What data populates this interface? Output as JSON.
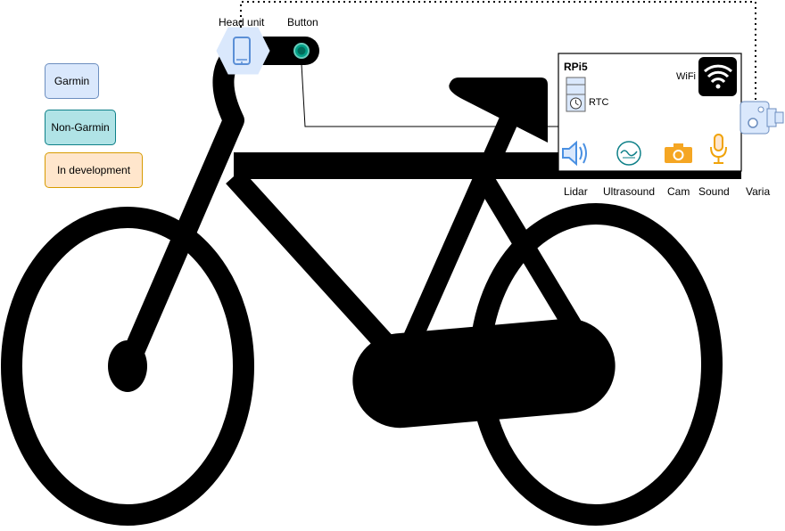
{
  "legend": [
    {
      "label": "Garmin",
      "fill": "#dae8fc",
      "stroke": "#6c8ebf"
    },
    {
      "label": "Non-Garmin",
      "fill": "#b0e3e6",
      "stroke": "#0e8088"
    },
    {
      "label": "In development",
      "fill": "#ffe6cc",
      "stroke": "#d79b00"
    }
  ],
  "labels": {
    "head_unit": "Head unit",
    "button": "Button",
    "rpi": "RPi5",
    "wifi": "WiFi",
    "rtc": "RTC",
    "lidar": "Lidar",
    "ultrasound": "Ultrasound",
    "cam": "Cam",
    "sound": "Sound",
    "varia": "Varia"
  },
  "colors": {
    "garmin_fill": "#dae8fc",
    "garmin_stroke": "#6c8ebf",
    "button_accent": "#00a087",
    "sensor_blue": "#4a90e2",
    "camera_orange": "#f5a623",
    "ultrasound_teal": "#0e8088",
    "frame": "#000000"
  },
  "icons": [
    "phone-icon",
    "round-button-icon",
    "wifi-icon",
    "rtc-clock-icon",
    "speaker-icon",
    "ultrasound-icon",
    "camera-icon",
    "microphone-icon",
    "varia-radar-icon"
  ]
}
